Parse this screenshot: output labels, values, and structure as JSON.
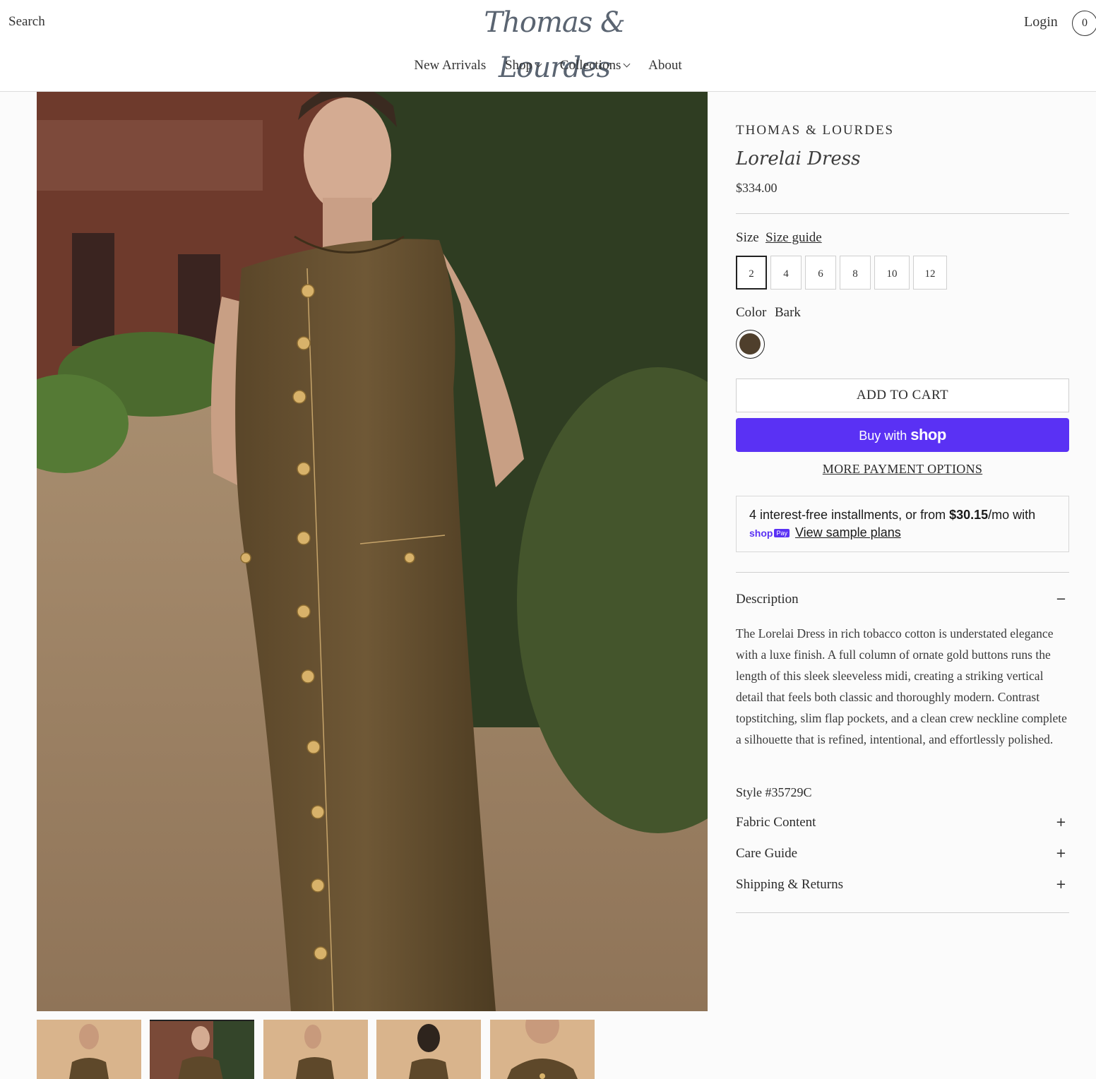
{
  "header": {
    "search_label": "Search",
    "logo_text": "Thomas & Lourdes",
    "login_label": "Login",
    "cart_count": "0"
  },
  "nav": {
    "items": [
      {
        "label": "New Arrivals",
        "dropdown": false
      },
      {
        "label": "Shop",
        "dropdown": true
      },
      {
        "label": "Collections",
        "dropdown": true
      },
      {
        "label": "About",
        "dropdown": false
      }
    ]
  },
  "product": {
    "brand": "THOMAS & LOURDES",
    "title": "Lorelai Dress",
    "price": "$334.00",
    "size_label": "Size",
    "size_guide_label": "Size guide",
    "sizes": [
      "2",
      "4",
      "6",
      "8",
      "10",
      "12"
    ],
    "selected_size": "2",
    "color_label": "Color",
    "color_name": "Bark",
    "color_hex": "#4f3f2c",
    "add_to_cart_label": "ADD TO CART",
    "buy_with_label": "Buy with",
    "shop_wordmark": "shop",
    "more_payment_label": "MORE PAYMENT OPTIONS",
    "installments": {
      "text_before": "4 interest-free installments, or from ",
      "amount": "$30.15",
      "text_after": "/mo with",
      "shoppay_wordmark": "shop",
      "shoppay_badge": "Pay",
      "view_plans_label": "View sample plans"
    },
    "description_heading": "Description",
    "description_icon": "−",
    "description_text": "The Lorelai Dress in rich tobacco cotton is understated elegance with a luxe finish. A full column of ornate gold buttons runs the length of this sleek sleeveless midi, creating a striking vertical detail that feels both classic and thoroughly modern. Contrast topstitching, slim flap pockets, and a clean crew neckline complete a silhouette that is refined, intentional, and effortlessly polished.",
    "style_number": "Style #35729C",
    "accordions": [
      {
        "label": "Fabric Content",
        "icon": "+"
      },
      {
        "label": "Care Guide",
        "icon": "+"
      },
      {
        "label": "Shipping & Returns",
        "icon": "+"
      }
    ]
  },
  "gallery": {
    "thumbnail_count": 5,
    "active_thumbnail": 2
  },
  "colors": {
    "accent_shop_pay": "#5a31f4",
    "dress": "#6b5535"
  }
}
